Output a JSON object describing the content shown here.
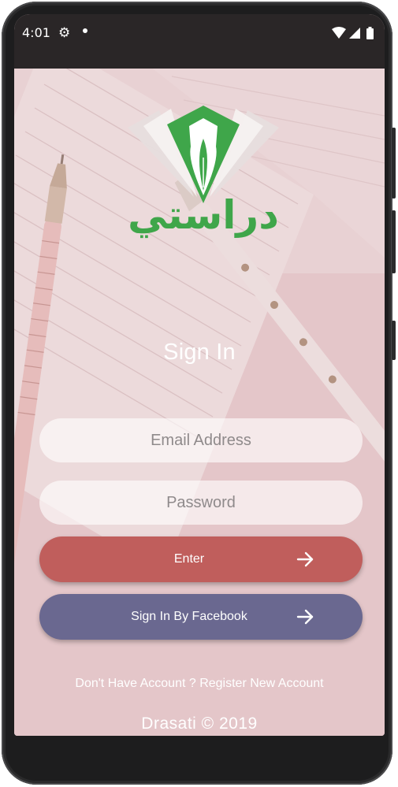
{
  "status_bar": {
    "time": "4:01",
    "icons": [
      "settings-icon",
      "notification-dot",
      "wifi-icon",
      "signal-icon",
      "battery-icon"
    ]
  },
  "logo": {
    "text": "دراستي",
    "color": "#3fa64a"
  },
  "page": {
    "title": "Sign In",
    "register_link": "Don't Have Account ? Register New Account",
    "footer": "Drasati © 2019"
  },
  "form": {
    "email_placeholder": "Email Address",
    "email_value": "",
    "password_placeholder": "Password",
    "password_value": ""
  },
  "buttons": {
    "enter_label": "Enter",
    "enter_color": "#c05e5c",
    "facebook_label": "Sign In By Facebook",
    "facebook_color": "#6a6890"
  }
}
